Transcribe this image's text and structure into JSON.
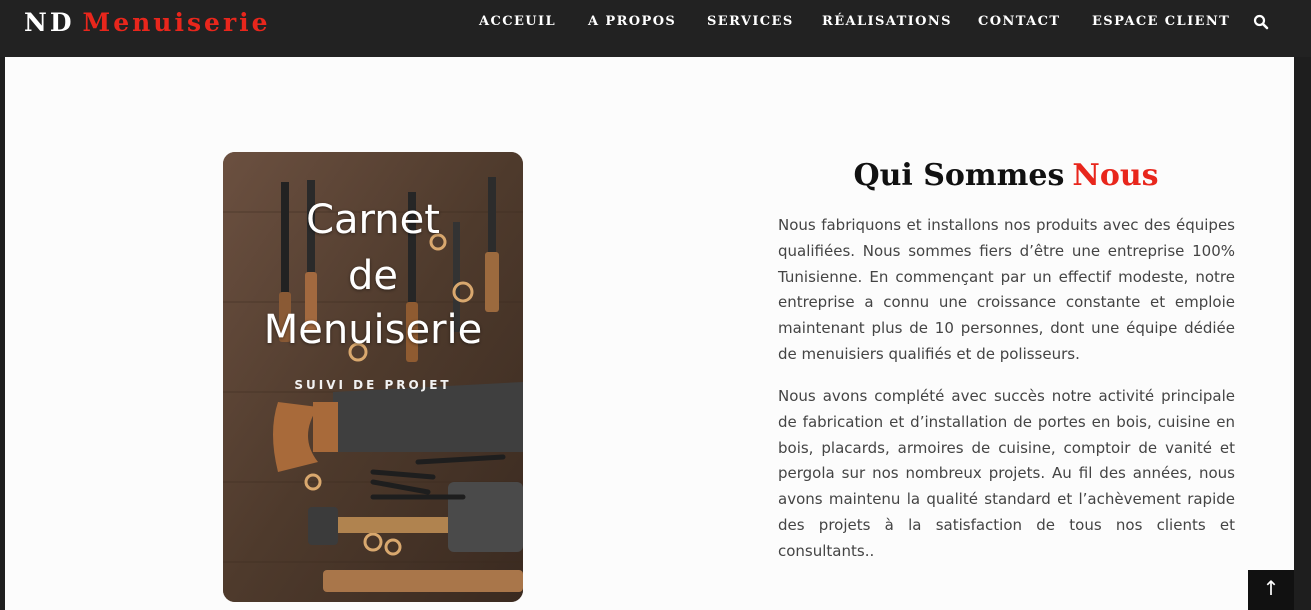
{
  "brand": {
    "part1": "ND",
    "part2": "Menuiserie"
  },
  "nav": {
    "items": [
      "ACCEUIL",
      "A PROPOS",
      "SERVICES",
      "RÉALISATIONS",
      "CONTACT",
      "ESPACE CLIENT"
    ],
    "search_icon": "search-icon"
  },
  "card": {
    "line1": "Carnet",
    "line2": "de",
    "line3": "Menuiserie",
    "subtitle": "SUIVI DE PROJET"
  },
  "section": {
    "title_part1": "Qui Sommes",
    "title_part2": "Nous",
    "paragraph1": "Nous fabriquons et installons nos produits avec des équipes qualifiées. Nous sommes fiers d’être une entreprise 100% Tunisienne. En commençant par un effectif modeste, notre entreprise a connu une croissance constante et emploie maintenant plus de 10 personnes, dont une équipe dédiée de menuisiers qualifiés et de polisseurs.",
    "paragraph2": "Nous avons complété avec succès notre activité principale de fabrication et d’installation de portes en bois, cuisine en bois, placards, armoires de cuisine, comptoir de vanité et pergola sur nos nombreux projets. Au fil des années, nous avons maintenu la qualité standard et l’achèvement rapide des projets à la satisfaction de tous nos clients et consultants.."
  },
  "back_to_top": {
    "icon": "arrow-up-icon",
    "glyph": "↑"
  },
  "colors": {
    "accent": "#e8261c",
    "topbar": "#222222",
    "text": "#444444"
  }
}
